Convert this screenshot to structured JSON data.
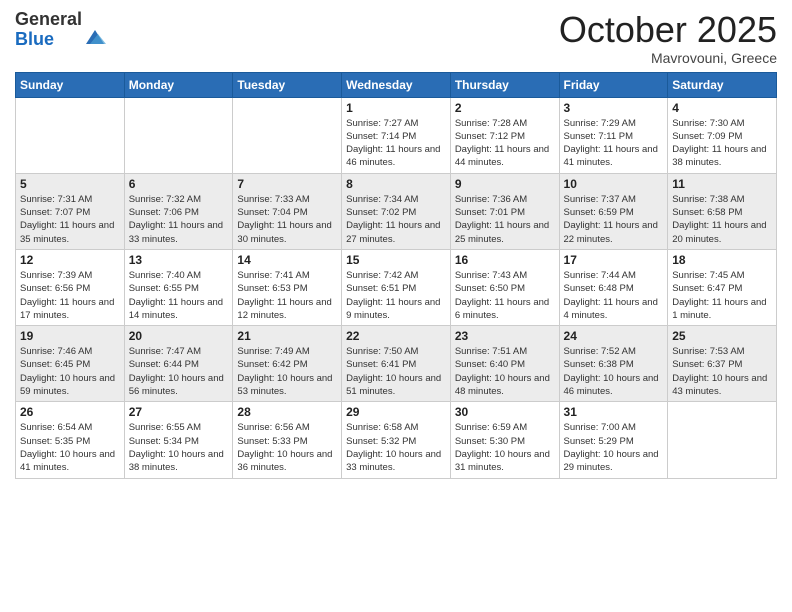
{
  "logo": {
    "general": "General",
    "blue": "Blue"
  },
  "header": {
    "month": "October 2025",
    "location": "Mavrovouni, Greece"
  },
  "weekdays": [
    "Sunday",
    "Monday",
    "Tuesday",
    "Wednesday",
    "Thursday",
    "Friday",
    "Saturday"
  ],
  "weeks": [
    [
      {
        "day": "",
        "info": ""
      },
      {
        "day": "",
        "info": ""
      },
      {
        "day": "",
        "info": ""
      },
      {
        "day": "1",
        "info": "Sunrise: 7:27 AM\nSunset: 7:14 PM\nDaylight: 11 hours\nand 46 minutes."
      },
      {
        "day": "2",
        "info": "Sunrise: 7:28 AM\nSunset: 7:12 PM\nDaylight: 11 hours\nand 44 minutes."
      },
      {
        "day": "3",
        "info": "Sunrise: 7:29 AM\nSunset: 7:11 PM\nDaylight: 11 hours\nand 41 minutes."
      },
      {
        "day": "4",
        "info": "Sunrise: 7:30 AM\nSunset: 7:09 PM\nDaylight: 11 hours\nand 38 minutes."
      }
    ],
    [
      {
        "day": "5",
        "info": "Sunrise: 7:31 AM\nSunset: 7:07 PM\nDaylight: 11 hours\nand 35 minutes."
      },
      {
        "day": "6",
        "info": "Sunrise: 7:32 AM\nSunset: 7:06 PM\nDaylight: 11 hours\nand 33 minutes."
      },
      {
        "day": "7",
        "info": "Sunrise: 7:33 AM\nSunset: 7:04 PM\nDaylight: 11 hours\nand 30 minutes."
      },
      {
        "day": "8",
        "info": "Sunrise: 7:34 AM\nSunset: 7:02 PM\nDaylight: 11 hours\nand 27 minutes."
      },
      {
        "day": "9",
        "info": "Sunrise: 7:36 AM\nSunset: 7:01 PM\nDaylight: 11 hours\nand 25 minutes."
      },
      {
        "day": "10",
        "info": "Sunrise: 7:37 AM\nSunset: 6:59 PM\nDaylight: 11 hours\nand 22 minutes."
      },
      {
        "day": "11",
        "info": "Sunrise: 7:38 AM\nSunset: 6:58 PM\nDaylight: 11 hours\nand 20 minutes."
      }
    ],
    [
      {
        "day": "12",
        "info": "Sunrise: 7:39 AM\nSunset: 6:56 PM\nDaylight: 11 hours\nand 17 minutes."
      },
      {
        "day": "13",
        "info": "Sunrise: 7:40 AM\nSunset: 6:55 PM\nDaylight: 11 hours\nand 14 minutes."
      },
      {
        "day": "14",
        "info": "Sunrise: 7:41 AM\nSunset: 6:53 PM\nDaylight: 11 hours\nand 12 minutes."
      },
      {
        "day": "15",
        "info": "Sunrise: 7:42 AM\nSunset: 6:51 PM\nDaylight: 11 hours\nand 9 minutes."
      },
      {
        "day": "16",
        "info": "Sunrise: 7:43 AM\nSunset: 6:50 PM\nDaylight: 11 hours\nand 6 minutes."
      },
      {
        "day": "17",
        "info": "Sunrise: 7:44 AM\nSunset: 6:48 PM\nDaylight: 11 hours\nand 4 minutes."
      },
      {
        "day": "18",
        "info": "Sunrise: 7:45 AM\nSunset: 6:47 PM\nDaylight: 11 hours\nand 1 minute."
      }
    ],
    [
      {
        "day": "19",
        "info": "Sunrise: 7:46 AM\nSunset: 6:45 PM\nDaylight: 10 hours\nand 59 minutes."
      },
      {
        "day": "20",
        "info": "Sunrise: 7:47 AM\nSunset: 6:44 PM\nDaylight: 10 hours\nand 56 minutes."
      },
      {
        "day": "21",
        "info": "Sunrise: 7:49 AM\nSunset: 6:42 PM\nDaylight: 10 hours\nand 53 minutes."
      },
      {
        "day": "22",
        "info": "Sunrise: 7:50 AM\nSunset: 6:41 PM\nDaylight: 10 hours\nand 51 minutes."
      },
      {
        "day": "23",
        "info": "Sunrise: 7:51 AM\nSunset: 6:40 PM\nDaylight: 10 hours\nand 48 minutes."
      },
      {
        "day": "24",
        "info": "Sunrise: 7:52 AM\nSunset: 6:38 PM\nDaylight: 10 hours\nand 46 minutes."
      },
      {
        "day": "25",
        "info": "Sunrise: 7:53 AM\nSunset: 6:37 PM\nDaylight: 10 hours\nand 43 minutes."
      }
    ],
    [
      {
        "day": "26",
        "info": "Sunrise: 6:54 AM\nSunset: 5:35 PM\nDaylight: 10 hours\nand 41 minutes."
      },
      {
        "day": "27",
        "info": "Sunrise: 6:55 AM\nSunset: 5:34 PM\nDaylight: 10 hours\nand 38 minutes."
      },
      {
        "day": "28",
        "info": "Sunrise: 6:56 AM\nSunset: 5:33 PM\nDaylight: 10 hours\nand 36 minutes."
      },
      {
        "day": "29",
        "info": "Sunrise: 6:58 AM\nSunset: 5:32 PM\nDaylight: 10 hours\nand 33 minutes."
      },
      {
        "day": "30",
        "info": "Sunrise: 6:59 AM\nSunset: 5:30 PM\nDaylight: 10 hours\nand 31 minutes."
      },
      {
        "day": "31",
        "info": "Sunrise: 7:00 AM\nSunset: 5:29 PM\nDaylight: 10 hours\nand 29 minutes."
      },
      {
        "day": "",
        "info": ""
      }
    ]
  ]
}
